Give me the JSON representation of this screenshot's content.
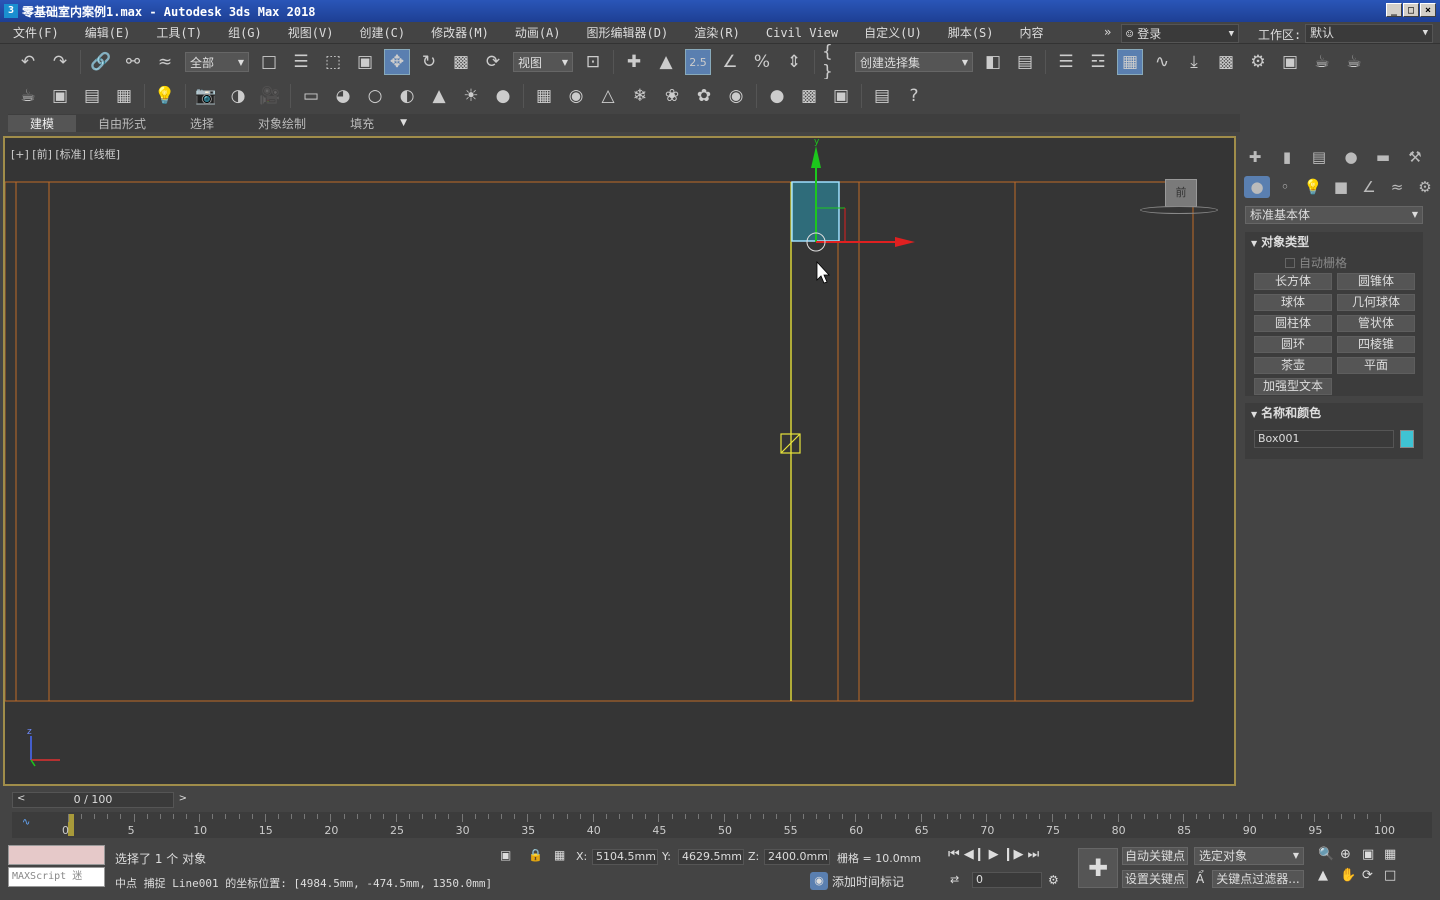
{
  "window": {
    "title": "零基础室内案例1.max - Autodesk 3ds Max 2018",
    "app_icon": "3"
  },
  "menu": [
    "文件(F)",
    "编辑(E)",
    "工具(T)",
    "组(G)",
    "视图(V)",
    "创建(C)",
    "修改器(M)",
    "动画(A)",
    "图形编辑器(D)",
    "渲染(R)",
    "Civil View",
    "自定义(U)",
    "脚本(S)",
    "内容"
  ],
  "menu_overflow": "»",
  "account": {
    "login_label": "登录",
    "workspace_label": "工作区:",
    "workspace_value": "默认"
  },
  "toolbar1": {
    "selection_filter": "全部",
    "ref_coord": "视图",
    "snap_value": "2.5",
    "named_selection": "创建选择集"
  },
  "ribbon": {
    "tabs": [
      "建模",
      "自由形式",
      "选择",
      "对象绘制",
      "填充"
    ],
    "active": "建模"
  },
  "viewport": {
    "label": "[+] [前] [标准] [线框]",
    "viewcube_label": "前"
  },
  "command_panel": {
    "category_dropdown": "标准基本体",
    "object_type_title": "对象类型",
    "auto_grid": "自动栅格",
    "buttons": [
      "长方体",
      "圆锥体",
      "球体",
      "几何球体",
      "圆柱体",
      "管状体",
      "圆环",
      "四棱锥",
      "茶壶",
      "平面",
      "加强型文本"
    ],
    "name_color_title": "名称和颜色",
    "object_name": "Box001",
    "object_color": "#3fc3d3"
  },
  "timeline": {
    "slider_label": "0 / 100",
    "ticks": [
      "0",
      "5",
      "10",
      "15",
      "20",
      "25",
      "30",
      "35",
      "40",
      "45",
      "50",
      "55",
      "60",
      "65",
      "70",
      "75",
      "80",
      "85",
      "90",
      "95",
      "100"
    ]
  },
  "status": {
    "maxscript": "MAXScript 迷",
    "selection_msg": "选择了 1 个 对象",
    "prompt_msg": "中点 捕捉 Line001 的坐标位置:  [4984.5mm, -474.5mm, 1350.0mm]",
    "x_label": "X:",
    "x_value": "5104.5mm",
    "y_label": "Y:",
    "y_value": "4629.5mm",
    "z_label": "Z:",
    "z_value": "2400.0mm",
    "grid_text": "栅格 = 10.0mm",
    "add_time_tag": "添加时间标记",
    "auto_key": "自动关键点",
    "set_key": "设置关键点",
    "key_filter_dd": "选定对象",
    "key_filters": "关键点过滤器...",
    "frame_value": "0"
  }
}
